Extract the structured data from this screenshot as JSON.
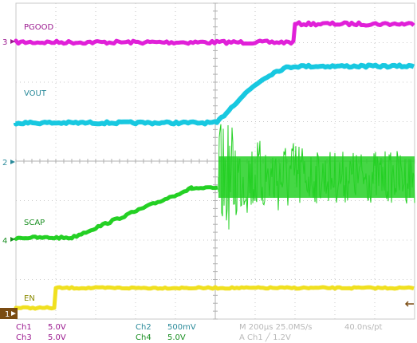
{
  "colors": {
    "ch1": "#f0e020",
    "ch2": "#18c8e0",
    "ch3": "#e020d8",
    "ch4": "#24d024",
    "grid": "#c8c8c8",
    "marker_fill": "#7a4b12"
  },
  "markers": {
    "left": [
      "3",
      "2",
      "4",
      "1"
    ],
    "right_icon": "left-arrow-icon"
  },
  "trace_labels": {
    "pgood": "PGOOD",
    "vout": "VOUT",
    "scap": "SCAP",
    "en": "EN"
  },
  "status_bar": {
    "ch1_name": "Ch1",
    "ch1_scale": "5.0V",
    "ch2_name": "Ch2",
    "ch2_scale": "500mV",
    "ch3_name": "Ch3",
    "ch3_scale": "5.0V",
    "ch4_name": "Ch4",
    "ch4_scale": "5.0V",
    "timebase": "M 200μs 25.0MS/s",
    "sample_interval": "40.0ns/pt",
    "trigger": "A  Ch1  ╱  1.2V"
  }
}
